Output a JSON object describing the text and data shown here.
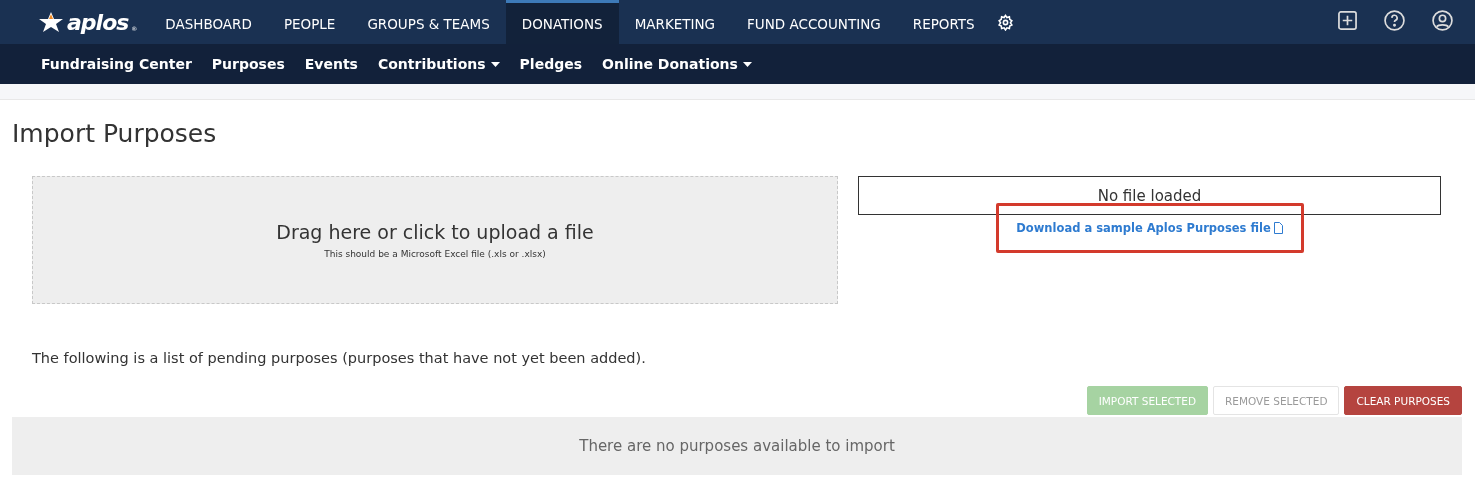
{
  "logo": {
    "text": "aplos",
    "mark": "®"
  },
  "main_nav": [
    {
      "label": "DASHBOARD",
      "selected": false
    },
    {
      "label": "PEOPLE",
      "selected": false
    },
    {
      "label": "GROUPS & TEAMS",
      "selected": false
    },
    {
      "label": "DONATIONS",
      "selected": true
    },
    {
      "label": "MARKETING",
      "selected": false
    },
    {
      "label": "FUND ACCOUNTING",
      "selected": false
    },
    {
      "label": "REPORTS",
      "selected": false
    }
  ],
  "sub_nav": [
    {
      "label": "Fundraising Center",
      "dropdown": false
    },
    {
      "label": "Purposes",
      "dropdown": false
    },
    {
      "label": "Events",
      "dropdown": false
    },
    {
      "label": "Contributions",
      "dropdown": true
    },
    {
      "label": "Pledges",
      "dropdown": false
    },
    {
      "label": "Online Donations",
      "dropdown": true
    }
  ],
  "page_title": "Import Purposes",
  "upload": {
    "title": "Drag here or click to upload a file",
    "hint": "This should be a Microsoft Excel file (.xls or .xlsx)"
  },
  "file_status": "No file loaded",
  "sample_link": {
    "label": "Download a sample Aplos Purposes file",
    "highlighted": true
  },
  "pending_note": "The following is a list of pending purposes (purposes that have not yet been added).",
  "buttons": [
    {
      "label": "IMPORT SELECTED",
      "kind": "success",
      "disabled": true
    },
    {
      "label": "REMOVE SELECTED",
      "kind": "default",
      "disabled": true
    },
    {
      "label": "CLEAR PURPOSES",
      "kind": "danger",
      "disabled": false
    }
  ],
  "empty_message": "There are no purposes available to import"
}
